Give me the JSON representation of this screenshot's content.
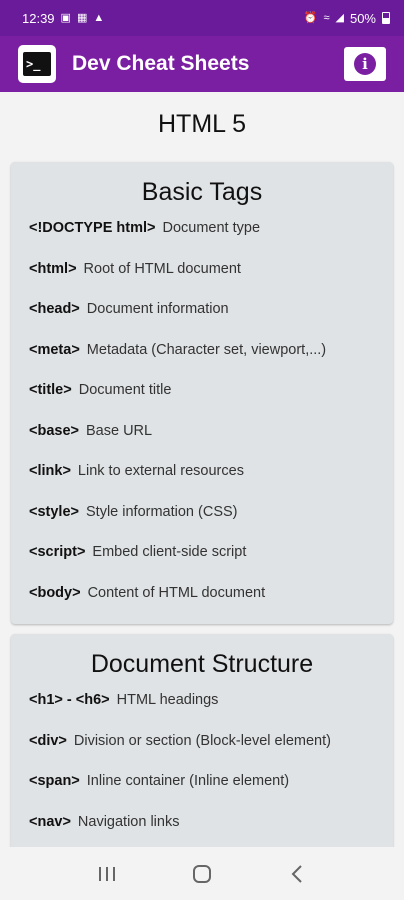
{
  "status_bar": {
    "time": "12:39",
    "battery": "50%"
  },
  "app_bar": {
    "title": "Dev Cheat Sheets",
    "terminal_glyph": ">_",
    "info_glyph": "i"
  },
  "page": {
    "title": "HTML 5"
  },
  "sections": [
    {
      "title": "Basic Tags",
      "items": [
        {
          "tag": "<!DOCTYPE html>",
          "desc": "Document type"
        },
        {
          "tag": "<html>",
          "desc": "Root of HTML document"
        },
        {
          "tag": "<head>",
          "desc": "Document information"
        },
        {
          "tag": "<meta>",
          "desc": "Metadata (Character set, viewport,...)"
        },
        {
          "tag": "<title>",
          "desc": "Document title"
        },
        {
          "tag": "<base>",
          "desc": "Base URL"
        },
        {
          "tag": "<link>",
          "desc": "Link to external resources"
        },
        {
          "tag": "<style>",
          "desc": "Style information (CSS)"
        },
        {
          "tag": "<script>",
          "desc": "Embed client-side script"
        },
        {
          "tag": "<body>",
          "desc": "Content of HTML document"
        }
      ]
    },
    {
      "title": "Document Structure",
      "items": [
        {
          "tag": "<h1> - <h6>",
          "desc": "HTML headings"
        },
        {
          "tag": "<div>",
          "desc": "Division or section (Block-level element)"
        },
        {
          "tag": "<span>",
          "desc": "Inline container (Inline element)"
        },
        {
          "tag": "<nav>",
          "desc": "Navigation links"
        }
      ]
    }
  ],
  "colors": {
    "status_bar": "#6a1b9a",
    "app_bar": "#7b1fa2",
    "card_bg": "#dfe3e5"
  }
}
